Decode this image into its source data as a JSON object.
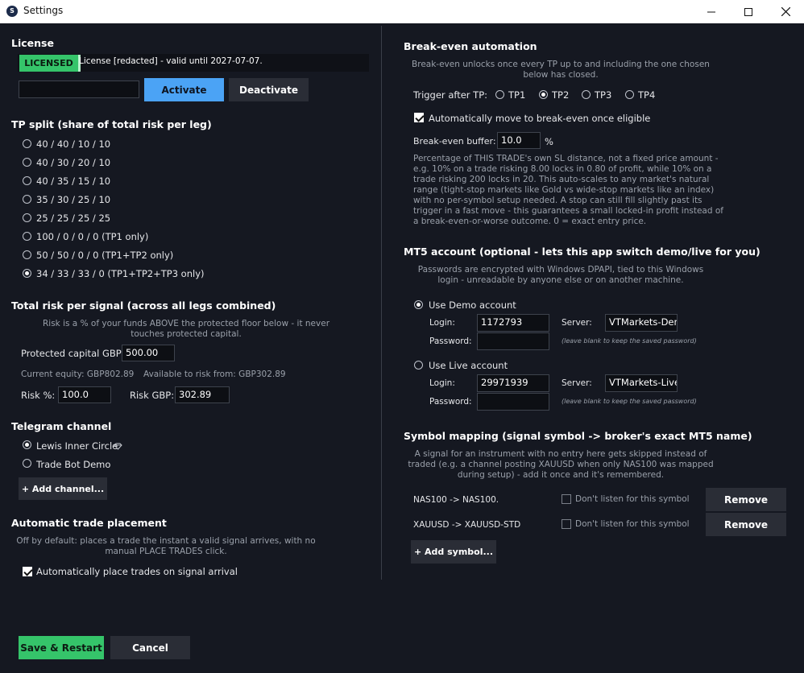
{
  "window": {
    "title": "Settings",
    "app_icon": "S"
  },
  "license": {
    "heading": "License",
    "badge": "LICENSED",
    "status": "License [redacted] - valid until 2027-07-07.",
    "key_value": "",
    "activate_label": "Activate",
    "deactivate_label": "Deactivate"
  },
  "tp_split": {
    "heading": "TP split (share of total risk per leg)",
    "options": [
      "40 / 40 / 10 / 10",
      "40 / 30 / 20 / 10",
      "40 / 35 / 15 / 10",
      "35 / 30 / 25 / 10",
      "25 / 25 / 25 / 25",
      "100 / 0 / 0 / 0 (TP1 only)",
      "50 / 50 / 0 / 0 (TP1+TP2 only)",
      "34 / 33 / 33 / 0 (TP1+TP2+TP3 only)"
    ],
    "selected_index": 7
  },
  "risk": {
    "heading": "Total risk per signal (across all legs combined)",
    "desc_line1": "Risk is a % of your funds ABOVE the protected floor below - it never",
    "desc_line2": "touches protected capital.",
    "protected_label": "Protected capital GBP:",
    "protected_value": "500.00",
    "equity": "Current equity: GBP802.89",
    "available": "Available to risk from: GBP302.89",
    "risk_pct_label": "Risk %:",
    "risk_pct_value": "100.0",
    "risk_gbp_label": "Risk GBP:",
    "risk_gbp_value": "302.89"
  },
  "telegram": {
    "heading": "Telegram channel",
    "channels": [
      "Lewis Inner Circle",
      "Trade Bot Demo"
    ],
    "selected_index": 0,
    "add_label": "+ Add channel..."
  },
  "auto_trade": {
    "heading": "Automatic trade placement",
    "desc_line1": "Off by default: places a trade the instant a valid signal arrives, with no",
    "desc_line2": "manual PLACE TRADES click.",
    "check_label": "Automatically place trades on signal arrival",
    "checked": true
  },
  "footer": {
    "save_label": "Save & Restart",
    "cancel_label": "Cancel"
  },
  "breakeven": {
    "heading": "Break-even automation",
    "desc_line1": "Break-even unlocks once every TP up to and including the one chosen",
    "desc_line2": "below has closed.",
    "trigger_label": "Trigger after TP:",
    "tps": [
      "TP1",
      "TP2",
      "TP3",
      "TP4"
    ],
    "selected_index": 1,
    "auto_move_label": "Automatically move to break-even once eligible",
    "auto_move_checked": true,
    "buffer_label": "Break-even buffer:",
    "buffer_value": "10.0",
    "buffer_unit": "%",
    "explain_lines": [
      "Percentage of THIS TRADE's own SL distance, not a fixed price amount -",
      "e.g. 10% on a trade risking 8.00 locks in 0.80 of profit, while 10% on a",
      "trade risking 200 locks in 20. This auto-scales to any market's natural",
      "range (tight-stop markets like Gold vs wide-stop markets like an index)",
      "with no per-symbol setup needed. A stop can still fill slightly past its",
      "trigger in a fast move - this guarantees a small locked-in profit instead of",
      "a break-even-or-worse outcome. 0 = exact entry price."
    ]
  },
  "mt5": {
    "heading": "MT5 account (optional - lets this app switch demo/live for you)",
    "desc_line1": "Passwords are encrypted with Windows DPAPI, tied to this Windows",
    "desc_line2": "login - unreadable by anyone else or on another machine.",
    "demo_label": "Use Demo account",
    "live_label": "Use Live account",
    "selected": "demo",
    "login_label": "Login:",
    "password_label": "Password:",
    "server_label": "Server:",
    "demo_login": "1172793",
    "demo_server": "VTMarkets-Demo",
    "live_login": "29971939",
    "live_server": "VTMarkets-Live",
    "password_hint": "(leave blank to keep the saved password)"
  },
  "symbols": {
    "heading": "Symbol mapping (signal symbol -> broker's exact MT5 name)",
    "desc_line1": "A signal for an instrument with no entry here gets skipped instead of",
    "desc_line2": "traded (e.g. a channel posting XAUUSD when only NAS100 was mapped",
    "desc_line3": "during setup) - add it once and it's remembered.",
    "rows": [
      {
        "mapping": "NAS100  ->  NAS100.",
        "ignore_label": "Don't listen for this symbol",
        "remove_label": "Remove"
      },
      {
        "mapping": "XAUUSD  ->  XAUUSD-STD",
        "ignore_label": "Don't listen for this symbol",
        "remove_label": "Remove"
      }
    ],
    "add_label": "+ Add symbol..."
  },
  "colors": {
    "background": "#151821",
    "accent_blue": "#4ba3f5",
    "accent_green": "#35c46a",
    "button_dark": "#2a2d36"
  }
}
